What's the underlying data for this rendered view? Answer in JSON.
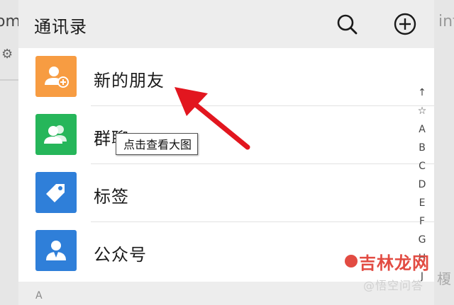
{
  "background": {
    "left_fragment": "om",
    "right_fragment": "infc",
    "right_mark": "榎"
  },
  "header": {
    "title": "通讯录",
    "search_icon": "search-icon",
    "add_icon": "plus-circle-icon"
  },
  "rows": [
    {
      "label": "新的朋友",
      "icon": "add-friend-icon",
      "color": "#f79c42"
    },
    {
      "label": "群聊",
      "icon": "group-chat-icon",
      "color": "#26b65a"
    },
    {
      "label": "标签",
      "icon": "tag-icon",
      "color": "#2f7fd9"
    },
    {
      "label": "公众号",
      "icon": "official-account-icon",
      "color": "#2f7fd9"
    }
  ],
  "section_letter": "A",
  "index_letters": [
    "↑",
    "☆",
    "A",
    "B",
    "C",
    "D",
    "E",
    "F",
    "G",
    "H",
    "J"
  ],
  "tooltip": "点击查看大图",
  "watermark": {
    "title": "吉林龙网",
    "subtitle": "@悟空问答"
  },
  "colors": {
    "arrow": "#e2161f",
    "header_bg": "#ededed"
  }
}
